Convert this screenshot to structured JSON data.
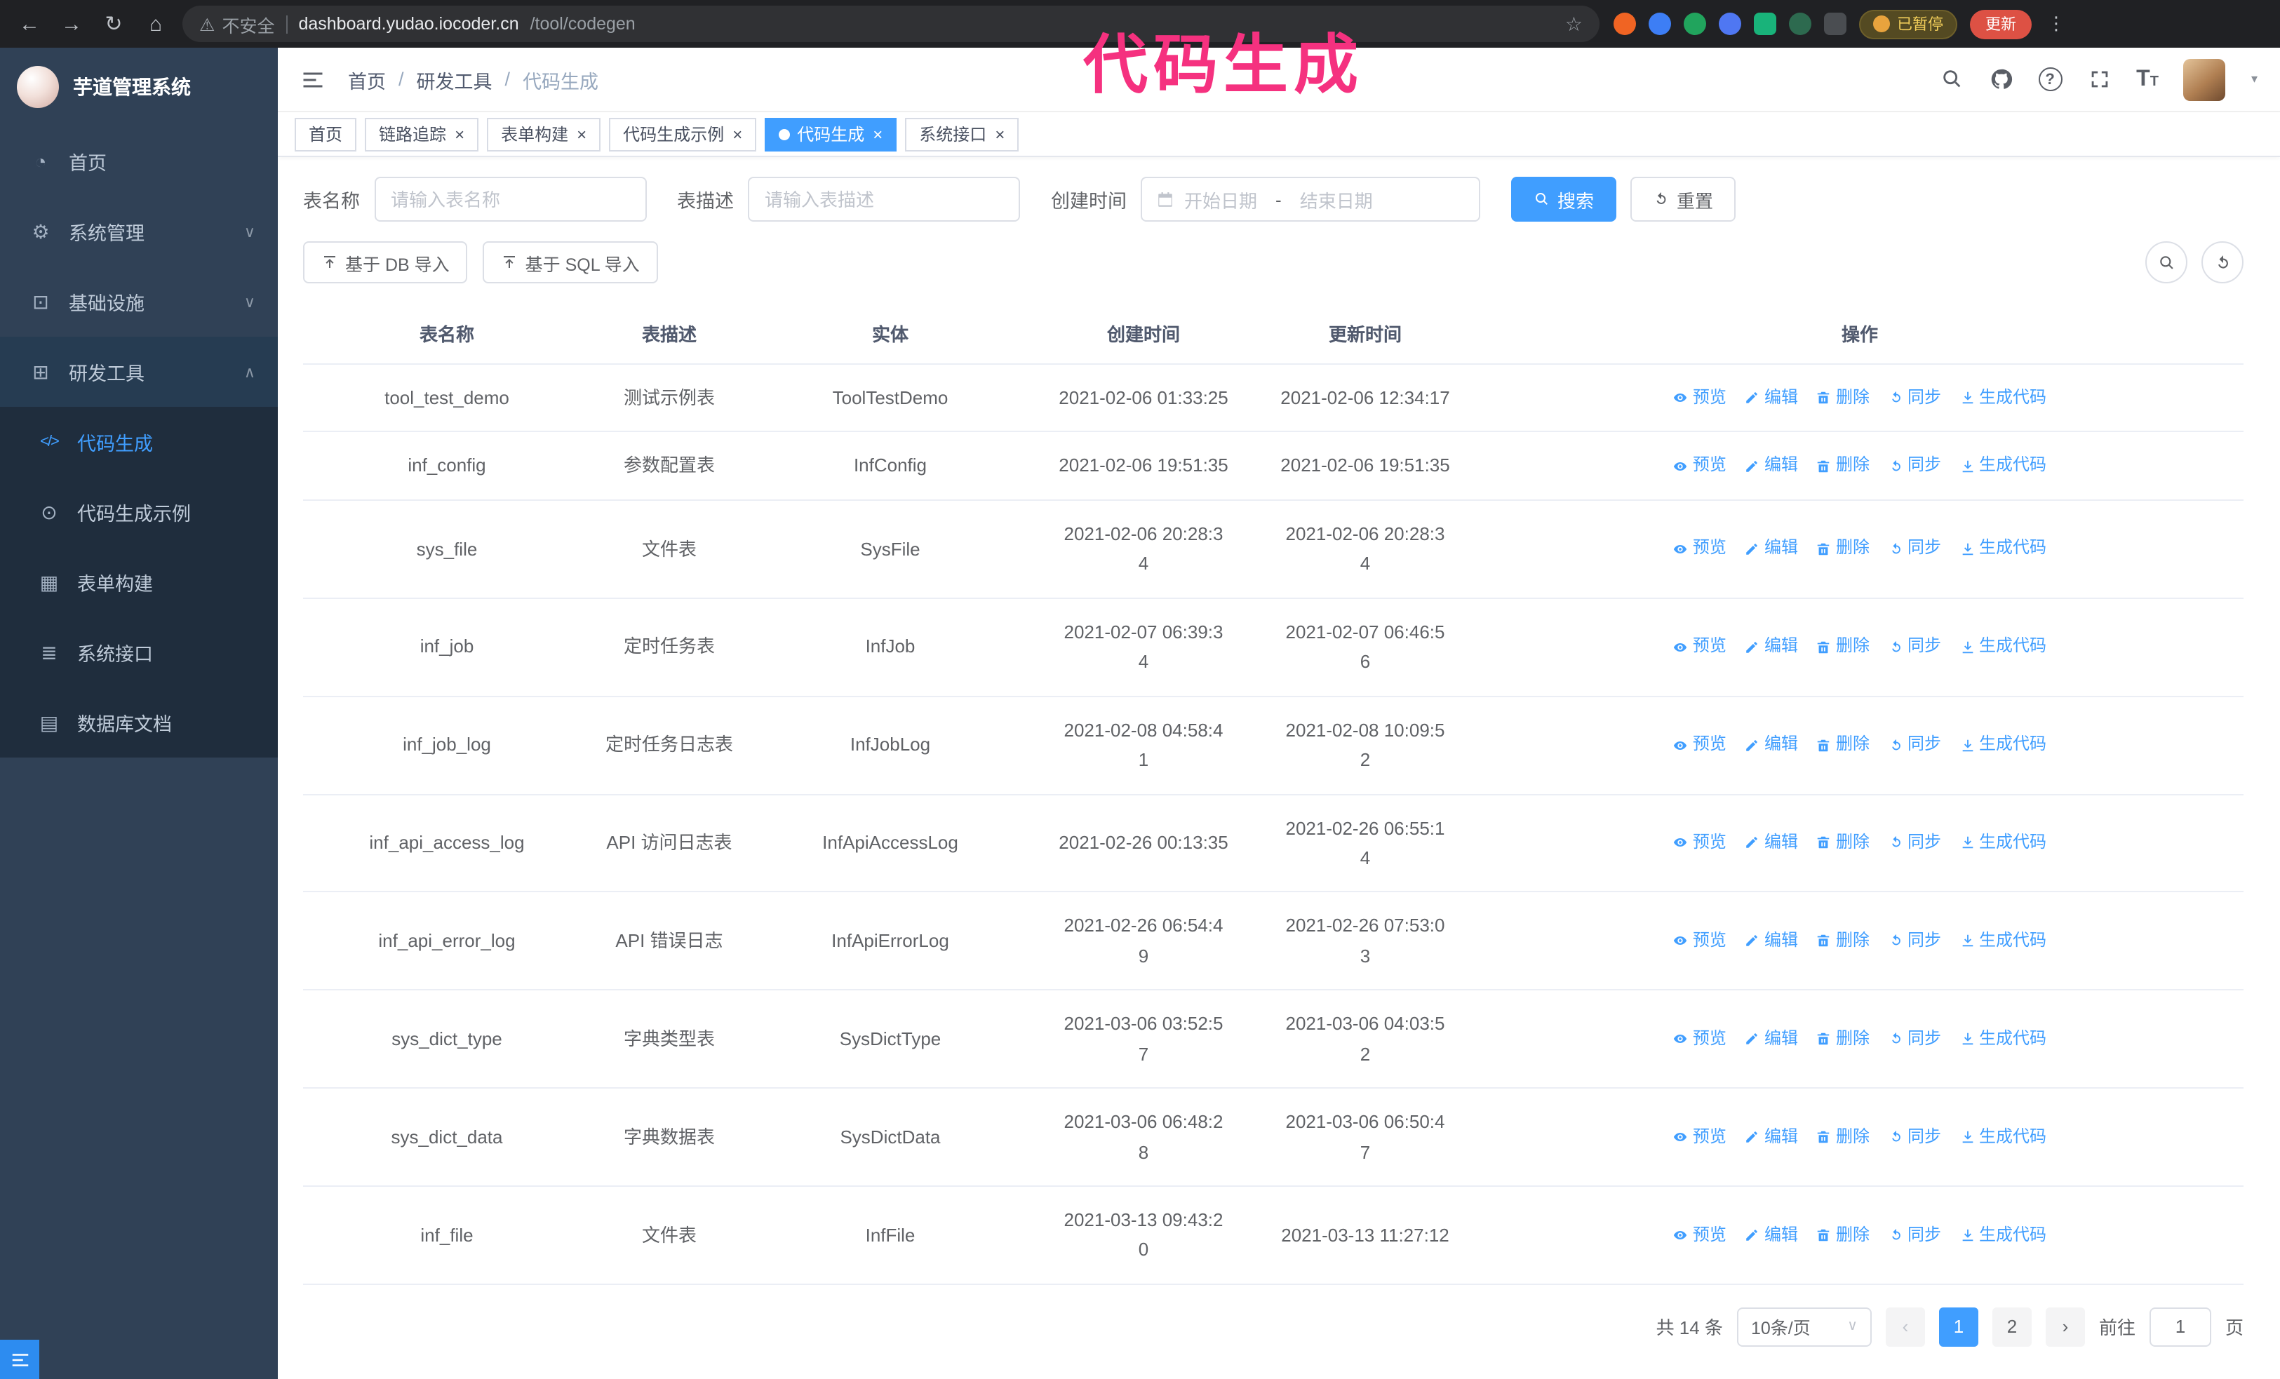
{
  "colors": {
    "accent": "#409eff",
    "annotation": "#f5317f",
    "sidebar_bg": "#304156",
    "submenu_bg": "#1f2d3d"
  },
  "annotation": {
    "text": "代码生成",
    "color": "#f5317f"
  },
  "browser": {
    "security_label": "不安全",
    "url_host": "dashboard.yudao.iocoder.cn",
    "url_path": "/tool/codegen",
    "paused_badge": "已暂停",
    "update_button": "更新"
  },
  "sidebar": {
    "logo_title": "芋道管理系统",
    "items": [
      {
        "label": "首页",
        "icon": "dashboard",
        "type": "item"
      },
      {
        "label": "系统管理",
        "icon": "gear",
        "type": "group",
        "state": "collapsed"
      },
      {
        "label": "基础设施",
        "icon": "infra",
        "type": "group",
        "state": "collapsed"
      },
      {
        "label": "研发工具",
        "icon": "tools",
        "type": "group",
        "state": "expanded"
      },
      {
        "label": "代码生成",
        "icon": "code",
        "type": "sub",
        "active": true
      },
      {
        "label": "代码生成示例",
        "icon": "example",
        "type": "sub"
      },
      {
        "label": "表单构建",
        "icon": "form",
        "type": "sub"
      },
      {
        "label": "系统接口",
        "icon": "api",
        "type": "sub"
      },
      {
        "label": "数据库文档",
        "icon": "db-doc",
        "type": "sub"
      }
    ]
  },
  "header": {
    "breadcrumb": [
      "首页",
      "研发工具",
      "代码生成"
    ]
  },
  "tabs": [
    {
      "label": "首页",
      "closable": false,
      "active": false
    },
    {
      "label": "链路追踪",
      "closable": true,
      "active": false
    },
    {
      "label": "表单构建",
      "closable": true,
      "active": false
    },
    {
      "label": "代码生成示例",
      "closable": true,
      "active": false
    },
    {
      "label": "代码生成",
      "closable": true,
      "active": true
    },
    {
      "label": "系统接口",
      "closable": true,
      "active": false
    }
  ],
  "filters": {
    "table_name_label": "表名称",
    "table_name_placeholder": "请输入表名称",
    "table_desc_label": "表描述",
    "table_desc_placeholder": "请输入表描述",
    "create_time_label": "创建时间",
    "date_start_placeholder": "开始日期",
    "date_separator": "-",
    "date_end_placeholder": "结束日期",
    "search_button": "搜索",
    "reset_button": "重置"
  },
  "toolbar": {
    "import_db_button": "基于 DB 导入",
    "import_sql_button": "基于 SQL 导入"
  },
  "table": {
    "columns": [
      "表名称",
      "表描述",
      "实体",
      "创建时间",
      "更新时间",
      "操作"
    ],
    "row_actions": [
      {
        "name": "preview",
        "label": "预览",
        "icon": "eye"
      },
      {
        "name": "edit",
        "label": "编辑",
        "icon": "edit"
      },
      {
        "name": "delete",
        "label": "删除",
        "icon": "delete"
      },
      {
        "name": "sync",
        "label": "同步",
        "icon": "sync"
      },
      {
        "name": "generate",
        "label": "生成代码",
        "icon": "download"
      }
    ],
    "rows": [
      {
        "name": "tool_test_demo",
        "desc": "测试示例表",
        "entity": "ToolTestDemo",
        "created": "2021-02-06 01:33:25",
        "updated": "2021-02-06 12:34:17"
      },
      {
        "name": "inf_config",
        "desc": "参数配置表",
        "entity": "InfConfig",
        "created": "2021-02-06 19:51:35",
        "updated": "2021-02-06 19:51:35"
      },
      {
        "name": "sys_file",
        "desc": "文件表",
        "entity": "SysFile",
        "created": "2021-02-06 20:28:3\n4",
        "updated": "2021-02-06 20:28:3\n4"
      },
      {
        "name": "inf_job",
        "desc": "定时任务表",
        "entity": "InfJob",
        "created": "2021-02-07 06:39:3\n4",
        "updated": "2021-02-07 06:46:5\n6"
      },
      {
        "name": "inf_job_log",
        "desc": "定时任务日志表",
        "entity": "InfJobLog",
        "created": "2021-02-08 04:58:4\n1",
        "updated": "2021-02-08 10:09:5\n2"
      },
      {
        "name": "inf_api_access_log",
        "desc": "API 访问日志表",
        "entity": "InfApiAccessLog",
        "created": "2021-02-26 00:13:35",
        "updated": "2021-02-26 06:55:1\n4"
      },
      {
        "name": "inf_api_error_log",
        "desc": "API 错误日志",
        "entity": "InfApiErrorLog",
        "created": "2021-02-26 06:54:4\n9",
        "updated": "2021-02-26 07:53:0\n3"
      },
      {
        "name": "sys_dict_type",
        "desc": "字典类型表",
        "entity": "SysDictType",
        "created": "2021-03-06 03:52:5\n7",
        "updated": "2021-03-06 04:03:5\n2"
      },
      {
        "name": "sys_dict_data",
        "desc": "字典数据表",
        "entity": "SysDictData",
        "created": "2021-03-06 06:48:2\n8",
        "updated": "2021-03-06 06:50:4\n7"
      },
      {
        "name": "inf_file",
        "desc": "文件表",
        "entity": "InfFile",
        "created": "2021-03-13 09:43:2\n0",
        "updated": "2021-03-13 11:27:12"
      }
    ]
  },
  "pagination": {
    "total_text": "共 14 条",
    "page_size": "10条/页",
    "pages": [
      "1",
      "2"
    ],
    "active_page": "1",
    "goto_label": "前往",
    "goto_value": "1",
    "goto_suffix": "页"
  }
}
